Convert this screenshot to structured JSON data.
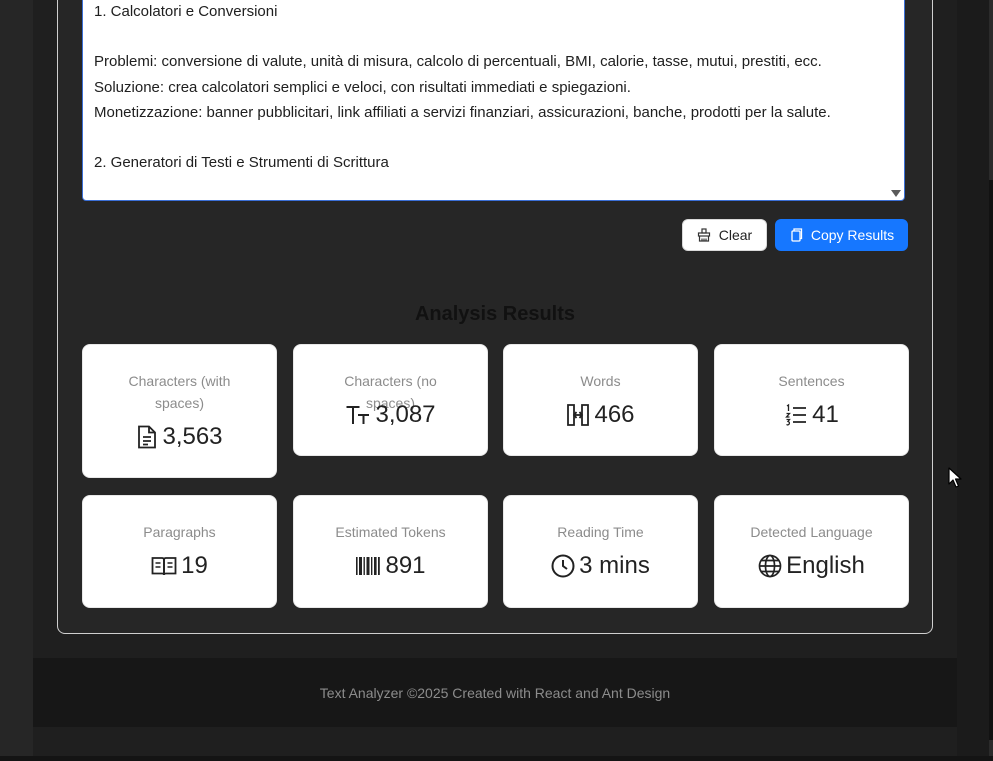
{
  "input": {
    "text": "1. Calcolatori e Conversioni\n\nProblemi: conversione di valute, unità di misura, calcolo di percentuali, BMI, calorie, tasse, mutui, prestiti, ecc.\nSoluzione: crea calcolatori semplici e veloci, con risultati immediati e spiegazioni.\nMonetizzazione: banner pubblicitari, link affiliati a servizi finanziari, assicurazioni, banche, prodotti per la salute.\n\n2. Generatori di Testi e Strumenti di Scrittura"
  },
  "actions": {
    "clear_label": "Clear",
    "copy_label": "Copy Results"
  },
  "results": {
    "title": "Analysis Results",
    "stats": [
      {
        "label": "Characters (with spaces)",
        "value": "3,563",
        "icon": "file-text-icon"
      },
      {
        "label": "Characters (no spaces)",
        "value": "3,087",
        "icon": "font-size-icon"
      },
      {
        "label": "Words",
        "value": "466",
        "icon": "column-width-icon"
      },
      {
        "label": "Sentences",
        "value": "41",
        "icon": "ordered-list-icon"
      },
      {
        "label": "Paragraphs",
        "value": "19",
        "icon": "book-icon"
      },
      {
        "label": "Estimated Tokens",
        "value": "891",
        "icon": "barcode-icon"
      },
      {
        "label": "Reading Time",
        "value": "3 mins",
        "icon": "clock-icon"
      },
      {
        "label": "Detected Language",
        "value": "English",
        "icon": "globe-icon"
      }
    ]
  },
  "footer": {
    "text": "Text Analyzer ©2025 Created with React and Ant Design"
  },
  "colors": {
    "primary": "#1677ff",
    "page_background": "#1f1f1f",
    "card_background": "#262626",
    "footer_background": "#171717"
  }
}
